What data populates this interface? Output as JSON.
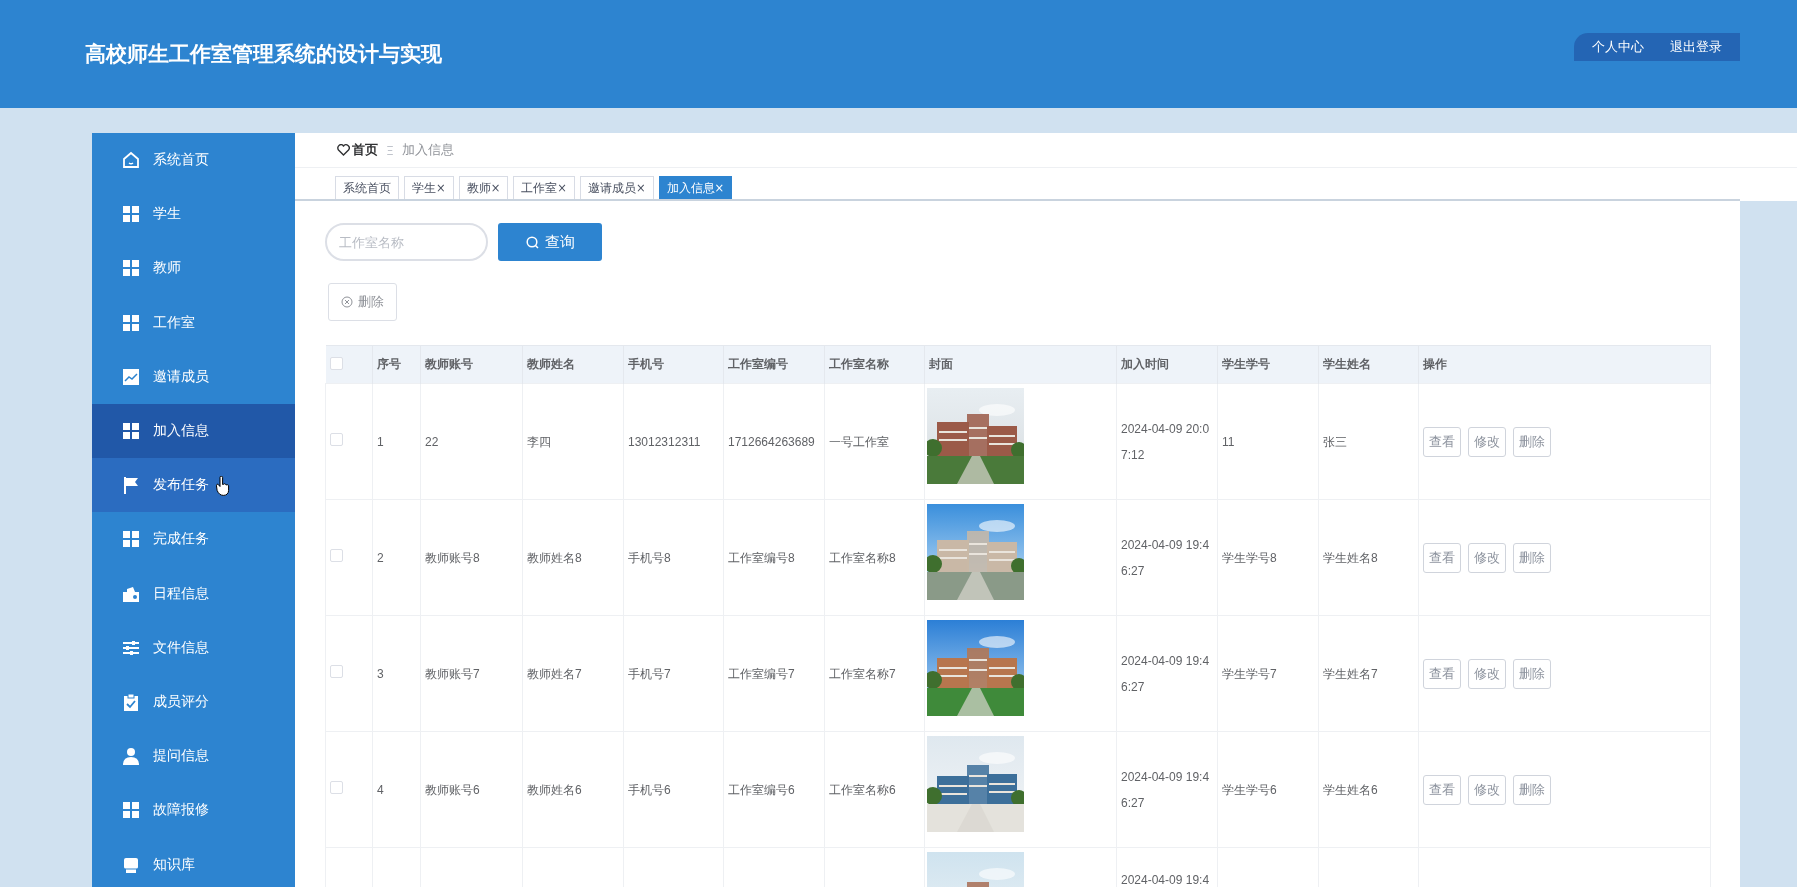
{
  "header": {
    "title": "高校师生工作室管理系统的设计与实现",
    "links": [
      "个人中心",
      "退出登录"
    ]
  },
  "sidebar": {
    "items": [
      {
        "label": "系统首页",
        "selected": false,
        "hovered": false
      },
      {
        "label": "学生",
        "selected": false,
        "hovered": false
      },
      {
        "label": "教师",
        "selected": false,
        "hovered": false
      },
      {
        "label": "工作室",
        "selected": false,
        "hovered": false
      },
      {
        "label": "邀请成员",
        "selected": false,
        "hovered": false
      },
      {
        "label": "加入信息",
        "selected": true,
        "hovered": false
      },
      {
        "label": "发布任务",
        "selected": false,
        "hovered": true
      },
      {
        "label": "完成任务",
        "selected": false,
        "hovered": false
      },
      {
        "label": "日程信息",
        "selected": false,
        "hovered": false
      },
      {
        "label": "文件信息",
        "selected": false,
        "hovered": false
      },
      {
        "label": "成员评分",
        "selected": false,
        "hovered": false
      },
      {
        "label": "提问信息",
        "selected": false,
        "hovered": false
      },
      {
        "label": "故障报修",
        "selected": false,
        "hovered": false
      },
      {
        "label": "知识库",
        "selected": false,
        "hovered": false
      }
    ]
  },
  "breadcrumb": {
    "home": "首页",
    "separator": "Ξ",
    "current": "加入信息"
  },
  "tabs": [
    {
      "label": "系统首页",
      "closable": false,
      "selected": false
    },
    {
      "label": "学生",
      "closable": true,
      "selected": false
    },
    {
      "label": "教师",
      "closable": true,
      "selected": false
    },
    {
      "label": "工作室",
      "closable": true,
      "selected": false
    },
    {
      "label": "邀请成员",
      "closable": true,
      "selected": false
    },
    {
      "label": "加入信息",
      "closable": true,
      "selected": true
    }
  ],
  "close_glyph": "×",
  "search": {
    "placeholder": "工作室名称",
    "button": "查询"
  },
  "delete_button": "删除",
  "table": {
    "columns": [
      "序号",
      "教师账号",
      "教师姓名",
      "手机号",
      "工作室编号",
      "工作室名称",
      "封面",
      "加入时间",
      "学生学号",
      "学生姓名",
      "操作"
    ],
    "all_checked": false,
    "rows": [
      {
        "kind": "full",
        "checked": false,
        "cells": [
          "1",
          "22",
          "李四",
          "13012312311",
          "1712664263689",
          "一号工作室"
        ],
        "time": "2024-04-09 20:07:12",
        "student_id": "11",
        "student_name": "张三",
        "actions": [
          "查看",
          "修改",
          "删除"
        ]
      },
      {
        "kind": "full",
        "checked": false,
        "cells": [
          "2",
          "教师账号8",
          "教师姓名8",
          "手机号8",
          "工作室编号8",
          "工作室名称8"
        ],
        "time": "2024-04-09 19:46:27",
        "student_id": "学生学号8",
        "student_name": "学生姓名8",
        "actions": [
          "查看",
          "修改",
          "删除"
        ]
      },
      {
        "kind": "full",
        "checked": false,
        "cells": [
          "3",
          "教师账号7",
          "教师姓名7",
          "手机号7",
          "工作室编号7",
          "工作室名称7"
        ],
        "time": "2024-04-09 19:46:27",
        "student_id": "学生学号7",
        "student_name": "学生姓名7",
        "actions": [
          "查看",
          "修改",
          "删除"
        ]
      },
      {
        "kind": "full",
        "checked": false,
        "cells": [
          "4",
          "教师账号6",
          "教师姓名6",
          "手机号6",
          "工作室编号6",
          "工作室名称6"
        ],
        "time": "2024-04-09 19:46:27",
        "student_id": "学生学号6",
        "student_name": "学生姓名6",
        "actions": [
          "查看",
          "修改",
          "删除"
        ]
      },
      {
        "kind": "cut",
        "time": "2024-04-09 19:4"
      }
    ]
  }
}
